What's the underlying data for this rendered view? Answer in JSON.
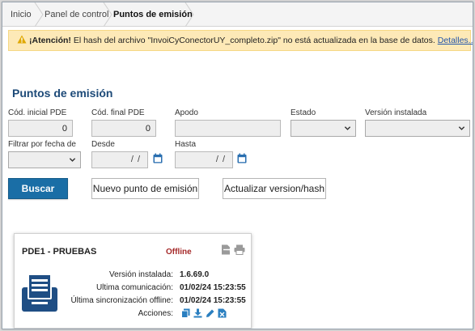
{
  "breadcrumb": [
    "Inicio",
    "Panel de control",
    "Puntos de emisión"
  ],
  "alert": {
    "prefix": "¡Atención!",
    "message": " El hash del archivo \"InvoiCyConectorUY_completo.zip\" no está actualizada en la base de datos. ",
    "link": "Detalles..."
  },
  "section_title": "Puntos de emisión",
  "form": {
    "cod_inicial_label": "Cód. inicial PDE",
    "cod_inicial_value": "0",
    "cod_final_label": "Cód. final PDE",
    "cod_final_value": "0",
    "apodo_label": "Apodo",
    "apodo_value": "",
    "estado_label": "Estado",
    "version_label": "Versión instalada",
    "filtro_fecha_label": "Filtrar por fecha de",
    "desde_label": "Desde",
    "desde_value": "/ /",
    "hasta_label": "Hasta",
    "hasta_value": "/ /"
  },
  "buttons": {
    "buscar": "Buscar",
    "nuevo": "Nuevo punto de emisión",
    "actualizar": "Actualizar version/hash"
  },
  "card": {
    "title": "PDE1 - PRUEBAS",
    "status": "Offline",
    "rows": [
      {
        "key": "Versión instalada:",
        "value": "1.6.69.0"
      },
      {
        "key": "Ultima comunicación:",
        "value": "01/02/24 15:23:55"
      },
      {
        "key": "Última sincronización offline:",
        "value": "01/02/24 15:23:55"
      }
    ],
    "actions_label": "Acciones:"
  },
  "colors": {
    "primary": "#1a6ea6",
    "title": "#1d4a78",
    "warning_bg": "#fde9b7",
    "offline": "#a52a2a",
    "icon_blue": "#2a7fc0"
  }
}
